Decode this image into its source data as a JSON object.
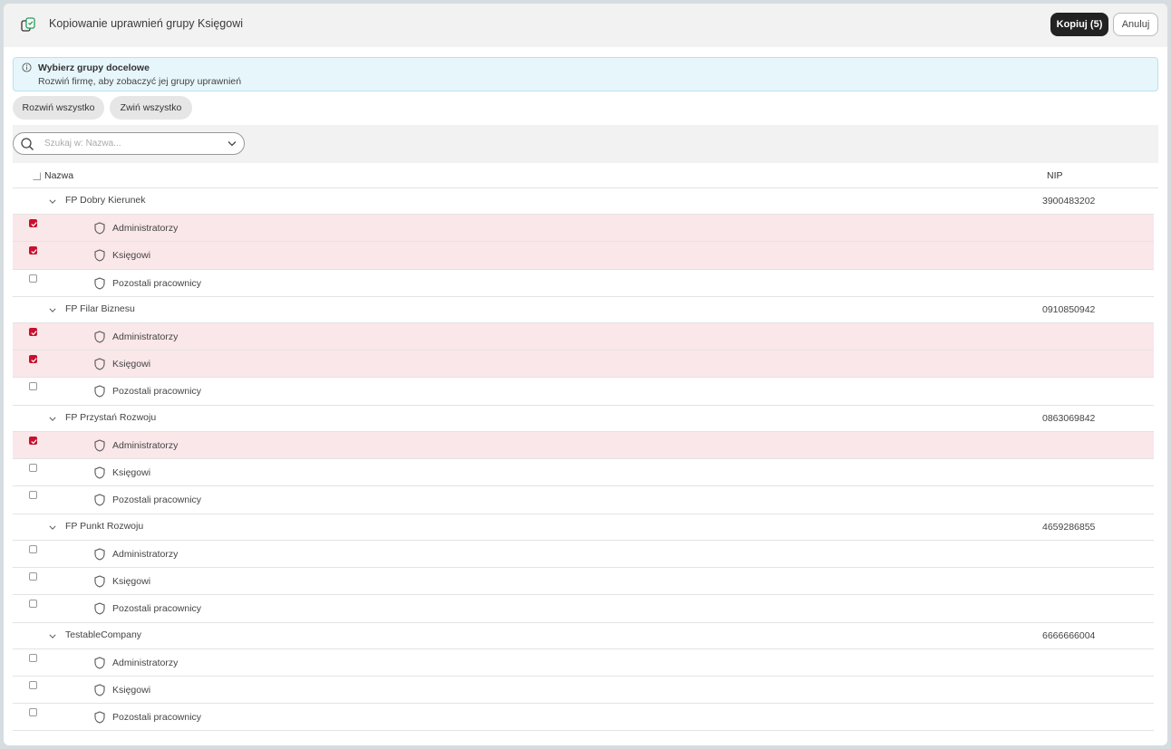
{
  "header": {
    "title": "Kopiowanie uprawnień grupy Księgowi",
    "copy_label": "Kopiuj (5)",
    "cancel_label": "Anuluj",
    "app_icon": "copy-icon"
  },
  "info": {
    "icon": "info-icon",
    "title": "Wybierz grupy docelowe",
    "text": "Rozwiń firmę, aby zobaczyć jej grupy uprawnień"
  },
  "actions": {
    "expand_all": "Rozwiń wszystko",
    "collapse_all": "Zwiń wszystko"
  },
  "search": {
    "placeholder": "Szukaj w: Nazwa...",
    "value": ""
  },
  "table": {
    "columns": {
      "name": "Nazwa",
      "nip": "NIP"
    },
    "companies": [
      {
        "name": "FP Dobry Kierunek",
        "nip": "3900483202",
        "expanded": true,
        "groups": [
          {
            "name": "Administratorzy",
            "checked": true
          },
          {
            "name": "Księgowi",
            "checked": true
          },
          {
            "name": "Pozostali pracownicy",
            "checked": false
          }
        ]
      },
      {
        "name": "FP Filar Biznesu",
        "nip": "0910850942",
        "expanded": true,
        "groups": [
          {
            "name": "Administratorzy",
            "checked": true
          },
          {
            "name": "Księgowi",
            "checked": true
          },
          {
            "name": "Pozostali pracownicy",
            "checked": false
          }
        ]
      },
      {
        "name": "FP Przystań Rozwoju",
        "nip": "0863069842",
        "expanded": true,
        "groups": [
          {
            "name": "Administratorzy",
            "checked": true
          },
          {
            "name": "Księgowi",
            "checked": false
          },
          {
            "name": "Pozostali pracownicy",
            "checked": false
          }
        ]
      },
      {
        "name": "FP Punkt Rozwoju",
        "nip": "4659286855",
        "expanded": true,
        "groups": [
          {
            "name": "Administratorzy",
            "checked": false
          },
          {
            "name": "Księgowi",
            "checked": false
          },
          {
            "name": "Pozostali pracownicy",
            "checked": false
          }
        ]
      },
      {
        "name": "TestableCompany",
        "nip": "6666666004",
        "expanded": true,
        "groups": [
          {
            "name": "Administratorzy",
            "checked": false
          },
          {
            "name": "Księgowi",
            "checked": false
          },
          {
            "name": "Pozostali pracownicy",
            "checked": false
          }
        ]
      }
    ]
  },
  "colors": {
    "accent": "#c8102e",
    "selected_row": "#fae7ea",
    "primary_button": "#222222",
    "info_bg": "#e7f6fb",
    "icon_green": "#1f9d55"
  }
}
